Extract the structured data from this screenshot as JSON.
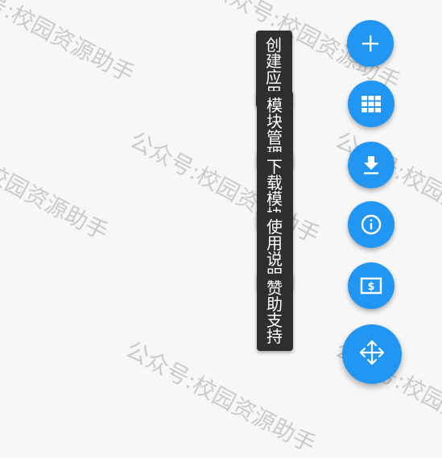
{
  "watermarks": [
    "公众号:校园资源助手",
    "公众号:校园资源助手",
    "校园资源助手",
    "公众号:校园资源助手",
    "公众号:校园资源助手",
    "公众号:校园资源助手"
  ],
  "menu": {
    "items": [
      {
        "label": "创建应用",
        "icon": "plus-icon"
      },
      {
        "label": "模块管理",
        "icon": "grid-icon"
      },
      {
        "label": "下载模块",
        "icon": "download-icon"
      },
      {
        "label": "使用说明",
        "icon": "info-icon"
      },
      {
        "label": "赞助支持",
        "icon": "dollar-bill-icon"
      }
    ],
    "main_icon": "move-arrows-icon"
  },
  "colors": {
    "accent": "#2196f3",
    "label_bg": "#2f2f2f",
    "background": "#f7f7f7"
  }
}
